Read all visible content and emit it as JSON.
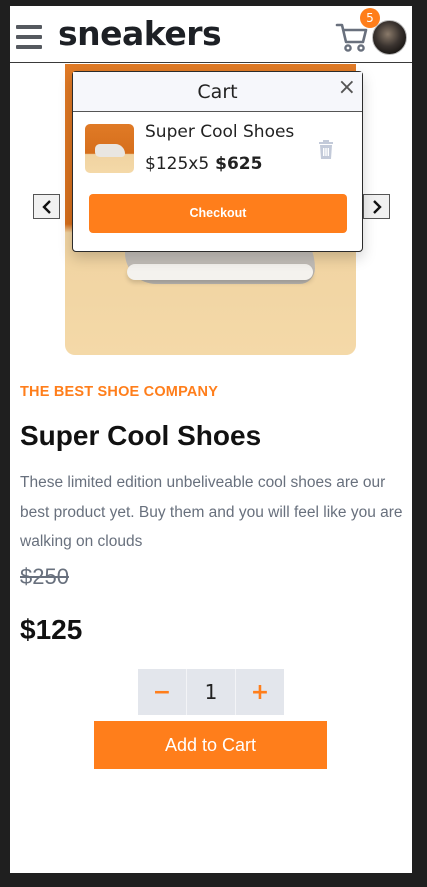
{
  "header": {
    "logo": "sneakers",
    "cart_count": "5"
  },
  "cart": {
    "title": "Cart",
    "close_label": "×",
    "item": {
      "name": "Super Cool Shoes",
      "unit_price_qty": "$125x5",
      "total": "$625"
    },
    "checkout_label": "Checkout"
  },
  "product": {
    "company": "THE BEST SHOE COMPANY",
    "title": "Super Cool Shoes",
    "description": "These limited edition unbeliveable cool shoes are our best product yet. Buy them and you will feel like you are walking on clouds",
    "original_price": "$250",
    "price": "$125",
    "quantity": "1",
    "decrement_label": "−",
    "increment_label": "+",
    "add_to_cart_label": "Add to Cart"
  },
  "colors": {
    "accent": "#ff7e1b",
    "text_dark": "#111111",
    "text_muted": "#68707d"
  },
  "icons": {
    "menu": "hamburger-icon",
    "cart": "cart-icon",
    "prev": "chevron-left-icon",
    "next": "chevron-right-icon",
    "delete": "trash-icon"
  }
}
